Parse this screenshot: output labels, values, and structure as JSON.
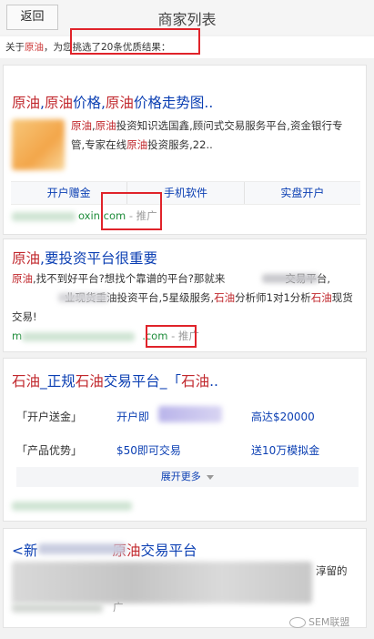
{
  "header": {
    "back_label": "返回",
    "title": "商家列表"
  },
  "summary": {
    "prefix": "关于",
    "keyword": "原油",
    "suffix": "，为您挑选了20条优质结果："
  },
  "results": [
    {
      "title_parts": [
        "原油",
        ",",
        "原油",
        "价格,",
        "原油",
        "价格走势图.."
      ],
      "desc_parts": [
        "原油",
        ",",
        "原油",
        "投资知识选国鑫,顾问式交易服务平台,资金银行专管,专家在线",
        "原油",
        "投资服务,22.."
      ],
      "links": [
        "开户赠金",
        "手机软件",
        "实盘开户"
      ],
      "url_tail": "oxin.com",
      "tag": " - 推广"
    },
    {
      "title_parts": [
        "原油",
        ",要投资平台很重要"
      ],
      "desc_parts": [
        "原油",
        ",找不到好平台?想找个靠谱的平台?那就来",
        "交易平台,",
        "业现货重油投资平台,5星级服务,",
        "石油",
        "分析师1对1分析",
        "石油",
        "现货交易!"
      ],
      "url_head": "m",
      "url_tail": ".com",
      "tag": " - 推广"
    },
    {
      "title_parts": [
        "石油",
        "_正规",
        "石油",
        "交易平台_「",
        "石油",
        ".."
      ],
      "rows": [
        {
          "label": "「开户送金」",
          "v1": "开户即",
          "v2": "高达$20000"
        },
        {
          "label": "「产品优势」",
          "v1": "$50即可交易",
          "v2": "送10万模拟金"
        }
      ],
      "expand_label": "展开更多"
    },
    {
      "title_parts": [
        "<新",
        "原油",
        "交易平台"
      ],
      "desc_tail": "淳留的",
      "tag": "广"
    }
  ],
  "watermark": {
    "text": "SEM联盟",
    "icon": "wechat-icon"
  },
  "colors": {
    "link": "#0b3fb3",
    "keyword": "#c1282d",
    "url": "#1e8c3a",
    "highlight": "#e0232a"
  }
}
